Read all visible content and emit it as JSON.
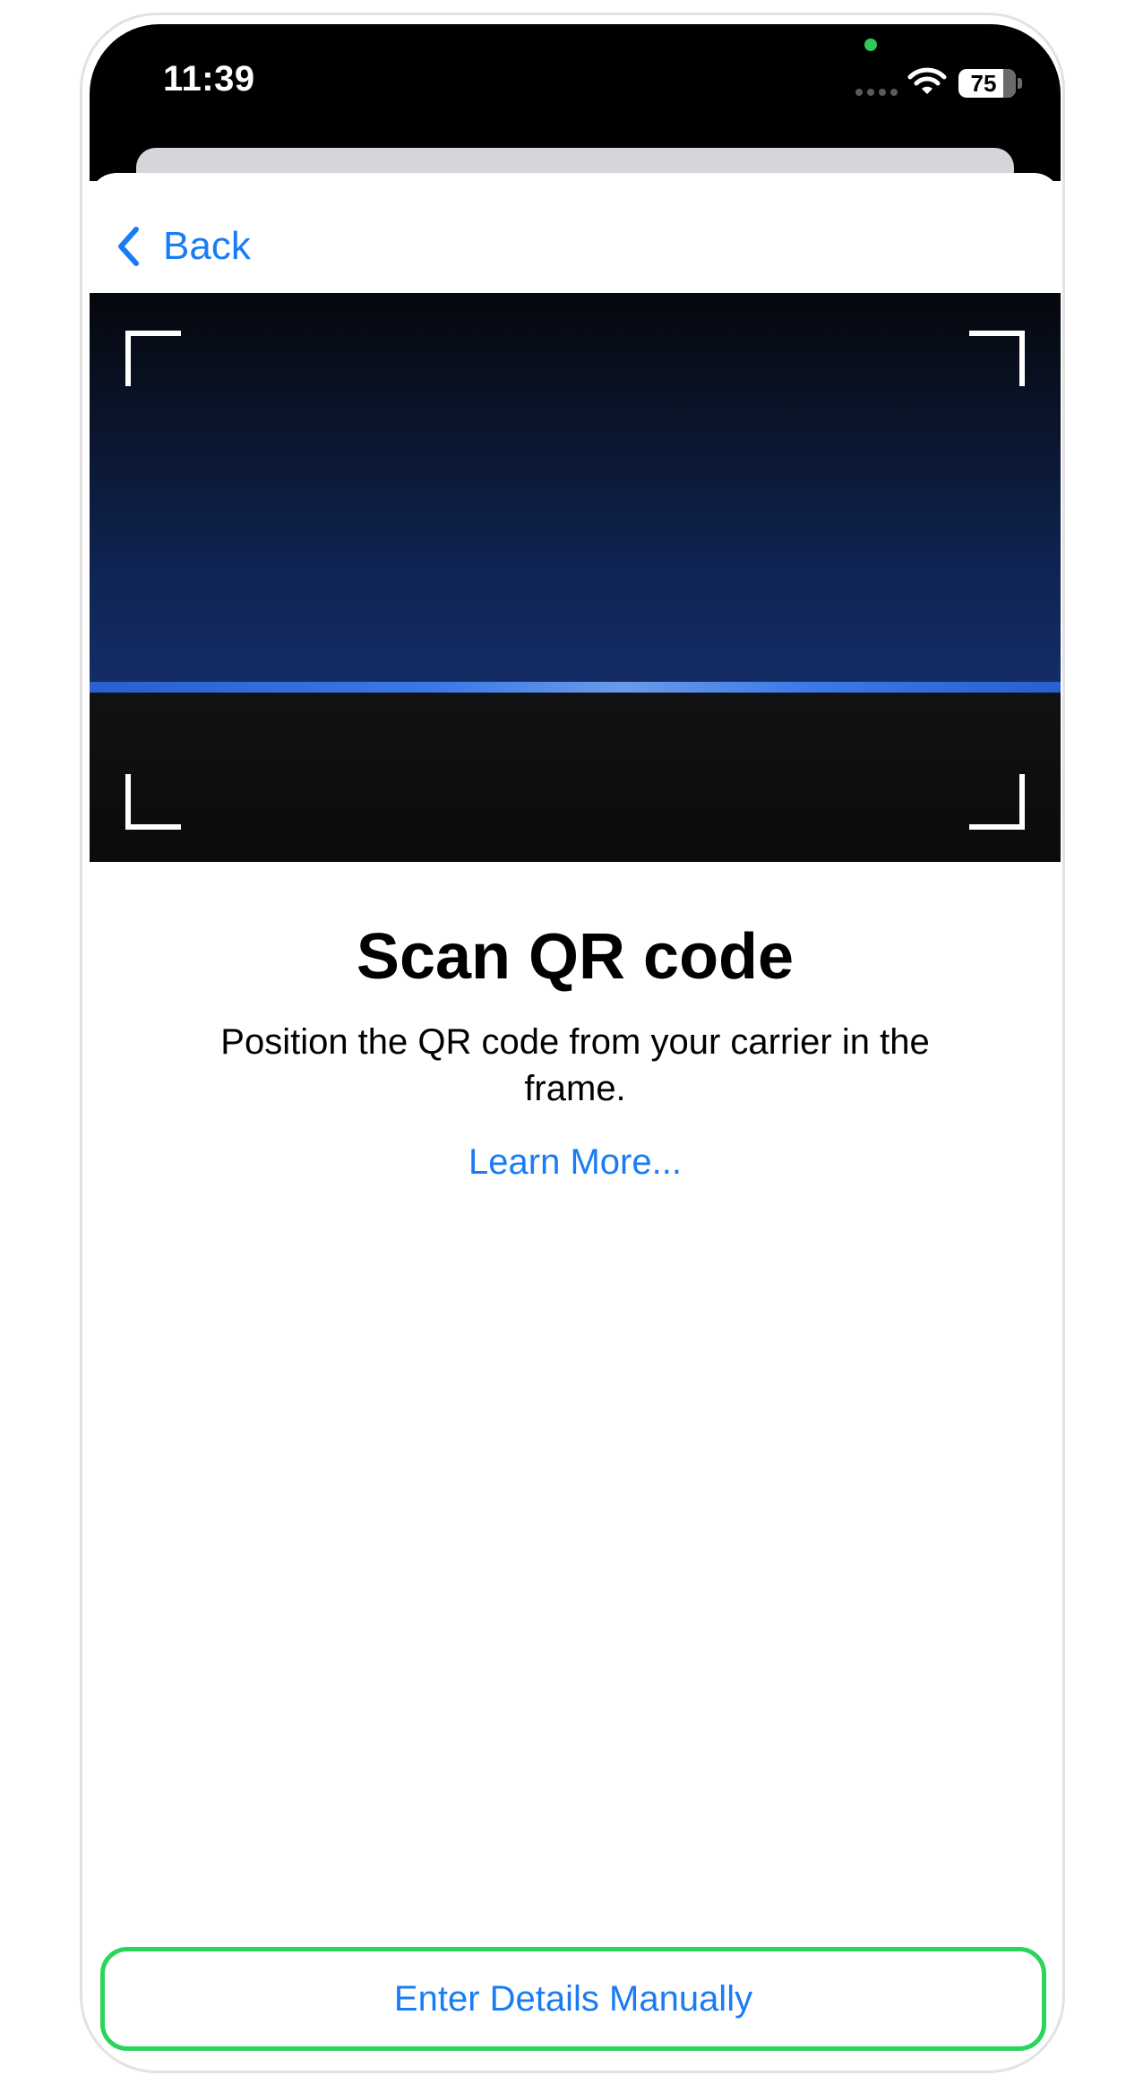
{
  "status_bar": {
    "time": "11:39",
    "battery_level": "75",
    "camera_indicator_color": "#34c759",
    "icons": [
      "cellular-signal-icon",
      "wifi-icon",
      "battery-icon"
    ]
  },
  "nav": {
    "back_label": "Back",
    "back_icon": "chevron-left-icon"
  },
  "scanner": {
    "frame_icon": "viewfinder-corners-icon"
  },
  "content": {
    "title": "Scan QR code",
    "subtitle": "Position the QR code from your carrier in the frame.",
    "learn_more": "Learn More..."
  },
  "footer": {
    "manual_button_label": "Enter Details Manually"
  },
  "colors": {
    "accent": "#1a7cf5",
    "highlight_border": "#2bd45b",
    "text": "#000000"
  }
}
